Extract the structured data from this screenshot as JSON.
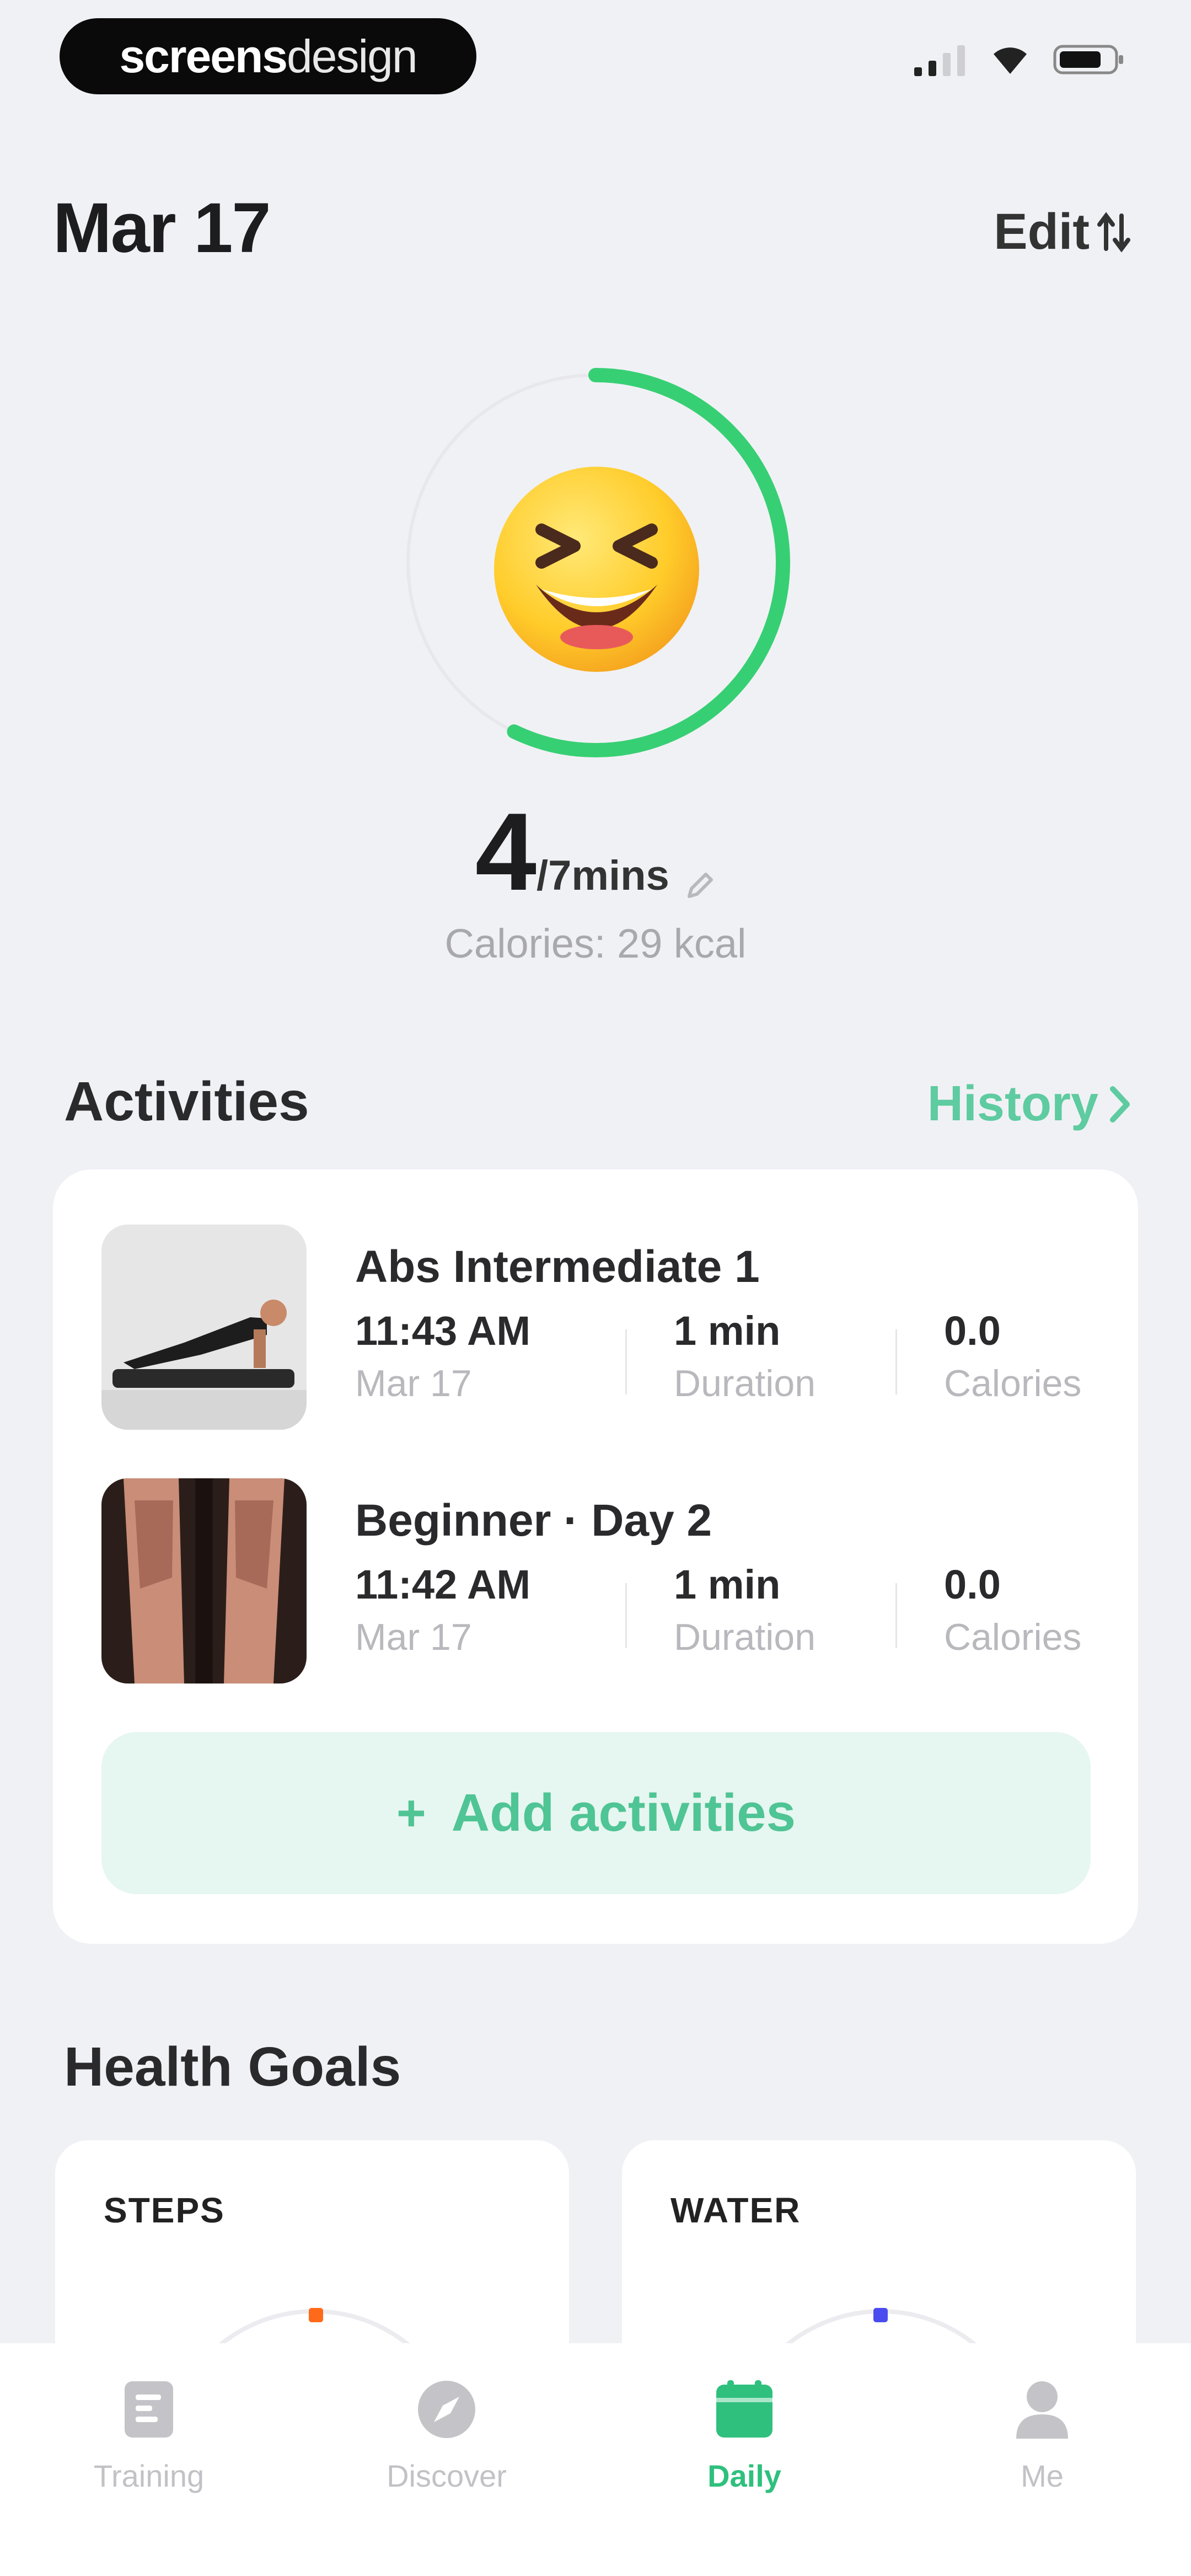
{
  "status_bar": {
    "brand_bold": "screens",
    "brand_light": "design",
    "icons": [
      "signal-icon",
      "wifi-icon",
      "battery-icon"
    ]
  },
  "header": {
    "date": "Mar 17",
    "edit_label": "Edit"
  },
  "progress": {
    "current": "4",
    "goal_label": "/7mins",
    "fraction": 0.5714,
    "calories": "Calories: 29 kcal",
    "emoji": "😆"
  },
  "activities": {
    "title": "Activities",
    "history_label": "History",
    "items": [
      {
        "name": "Abs Intermediate 1",
        "time": "11:43 AM",
        "date": "Mar 17",
        "duration": "1 min",
        "duration_label": "Duration",
        "calories": "0.0",
        "calories_label": "Calories"
      },
      {
        "name": "Beginner · Day 2",
        "time": "11:42 AM",
        "date": "Mar 17",
        "duration": "1 min",
        "duration_label": "Duration",
        "calories": "0.0",
        "calories_label": "Calories"
      }
    ],
    "add_label": "Add activities"
  },
  "health_goals": {
    "title": "Health Goals",
    "cards": [
      {
        "title": "STEPS",
        "accent": "#ff6a1a"
      },
      {
        "title": "WATER",
        "accent": "#4a4cf0"
      }
    ]
  },
  "nav": {
    "items": [
      {
        "label": "Training",
        "active": false
      },
      {
        "label": "Discover",
        "active": false
      },
      {
        "label": "Daily",
        "active": true
      },
      {
        "label": "Me",
        "active": false
      }
    ]
  },
  "colors": {
    "accent_green": "#2fc07e",
    "background": "#f0f1f5"
  }
}
